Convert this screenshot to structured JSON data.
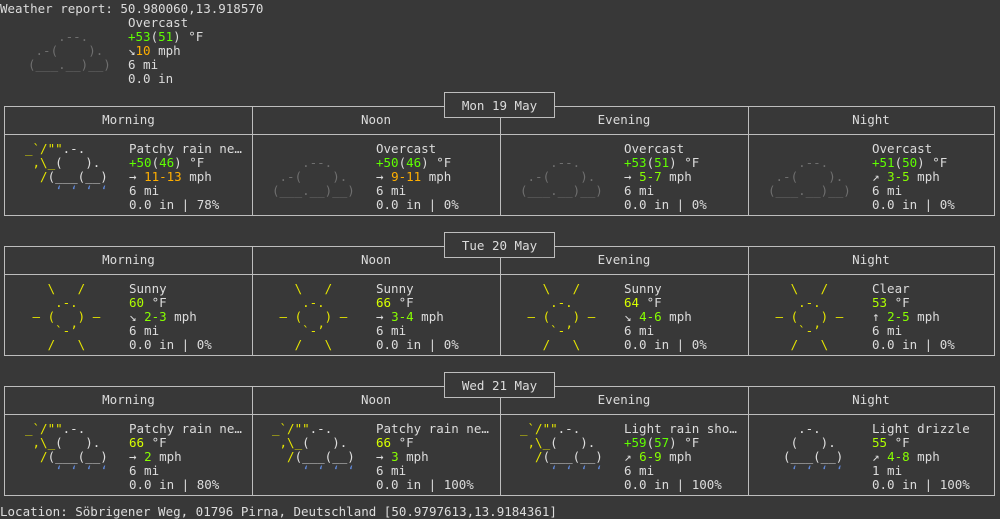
{
  "report": {
    "title": "Weather report: 50.980060,13.918570",
    "current": {
      "condition": "Overcast",
      "temp_main": "+53",
      "temp_feels": "51",
      "temp_unit": " °F",
      "wind_dir": "↘",
      "wind": "10",
      "wind_unit": " mph",
      "visibility": "6 mi",
      "precip": "0.0 in"
    }
  },
  "periods": [
    "Morning",
    "Noon",
    "Evening",
    "Night"
  ],
  "days": [
    {
      "date": "Mon 19 May",
      "cells": [
        {
          "icon": "patchy-rain",
          "condition": "Patchy rain ne…",
          "temp": "+50",
          "feels": "46",
          "unit": " °F",
          "wind_dir": "→",
          "wind": "11-13",
          "unit_w": " mph",
          "vis": "6 mi",
          "precip": "0.0 in | 78%"
        },
        {
          "icon": "overcast",
          "condition": "Overcast",
          "temp": "+50",
          "feels": "46",
          "unit": " °F",
          "wind_dir": "→",
          "wind": "9-11",
          "unit_w": " mph",
          "vis": "6 mi",
          "precip": "0.0 in | 0%"
        },
        {
          "icon": "overcast",
          "condition": "Overcast",
          "temp": "+53",
          "feels": "51",
          "unit": " °F",
          "wind_dir": "→",
          "wind": "5-7",
          "unit_w": " mph",
          "vis": "6 mi",
          "precip": "0.0 in | 0%"
        },
        {
          "icon": "overcast",
          "condition": "Overcast",
          "temp": "+51",
          "feels": "50",
          "unit": " °F",
          "wind_dir": "↗",
          "wind": "3-5",
          "unit_w": " mph",
          "vis": "6 mi",
          "precip": "0.0 in | 0%"
        }
      ]
    },
    {
      "date": "Tue 20 May",
      "cells": [
        {
          "icon": "sunny",
          "condition": "Sunny",
          "temp": "60",
          "feels": "",
          "unit": " °F",
          "wind_dir": "↘",
          "wind": "2-3",
          "unit_w": " mph",
          "vis": "6 mi",
          "precip": "0.0 in | 0%"
        },
        {
          "icon": "sunny",
          "condition": "Sunny",
          "temp": "66",
          "feels": "",
          "unit": " °F",
          "wind_dir": "→",
          "wind": "3-4",
          "unit_w": " mph",
          "vis": "6 mi",
          "precip": "0.0 in | 0%"
        },
        {
          "icon": "sunny",
          "condition": "Sunny",
          "temp": "64",
          "feels": "",
          "unit": " °F",
          "wind_dir": "↘",
          "wind": "4-6",
          "unit_w": " mph",
          "vis": "6 mi",
          "precip": "0.0 in | 0%"
        },
        {
          "icon": "sunny",
          "condition": "Clear",
          "temp": "53",
          "feels": "",
          "unit": " °F",
          "wind_dir": "↑",
          "wind": "2-5",
          "unit_w": " mph",
          "vis": "6 mi",
          "precip": "0.0 in | 0%"
        }
      ]
    },
    {
      "date": "Wed 21 May",
      "cells": [
        {
          "icon": "patchy-rain",
          "condition": "Patchy rain ne…",
          "temp": "66",
          "feels": "",
          "unit": " °F",
          "wind_dir": "→",
          "wind": "2",
          "unit_w": " mph",
          "vis": "6 mi",
          "precip": "0.0 in | 80%"
        },
        {
          "icon": "patchy-rain",
          "condition": "Patchy rain ne…",
          "temp": "66",
          "feels": "",
          "unit": " °F",
          "wind_dir": "→",
          "wind": "3",
          "unit_w": " mph",
          "vis": "6 mi",
          "precip": "0.0 in | 100%"
        },
        {
          "icon": "patchy-rain",
          "condition": "Light rain sho…",
          "temp": "+59",
          "feels": "57",
          "unit": " °F",
          "wind_dir": "↗",
          "wind": "6-9",
          "unit_w": " mph",
          "vis": "6 mi",
          "precip": "0.0 in | 100%"
        },
        {
          "icon": "drizzle",
          "condition": "Light drizzle",
          "temp": "55",
          "feels": "",
          "unit": " °F",
          "wind_dir": "↗",
          "wind": "4-8",
          "unit_w": " mph",
          "vis": "1 mi",
          "precip": "0.0 in | 100%"
        }
      ]
    }
  ],
  "location": "Location: Söbrigener Weg, 01796 Pirna, Deutschland [50.9797613,13.9184361]",
  "colors": {
    "background": "#383838",
    "text": "#dcdcdc",
    "sun": "#e6e600",
    "rain_drop": "#5f87d7",
    "temp_green": "#5fff00",
    "wind_orange": "#ffaf00"
  }
}
